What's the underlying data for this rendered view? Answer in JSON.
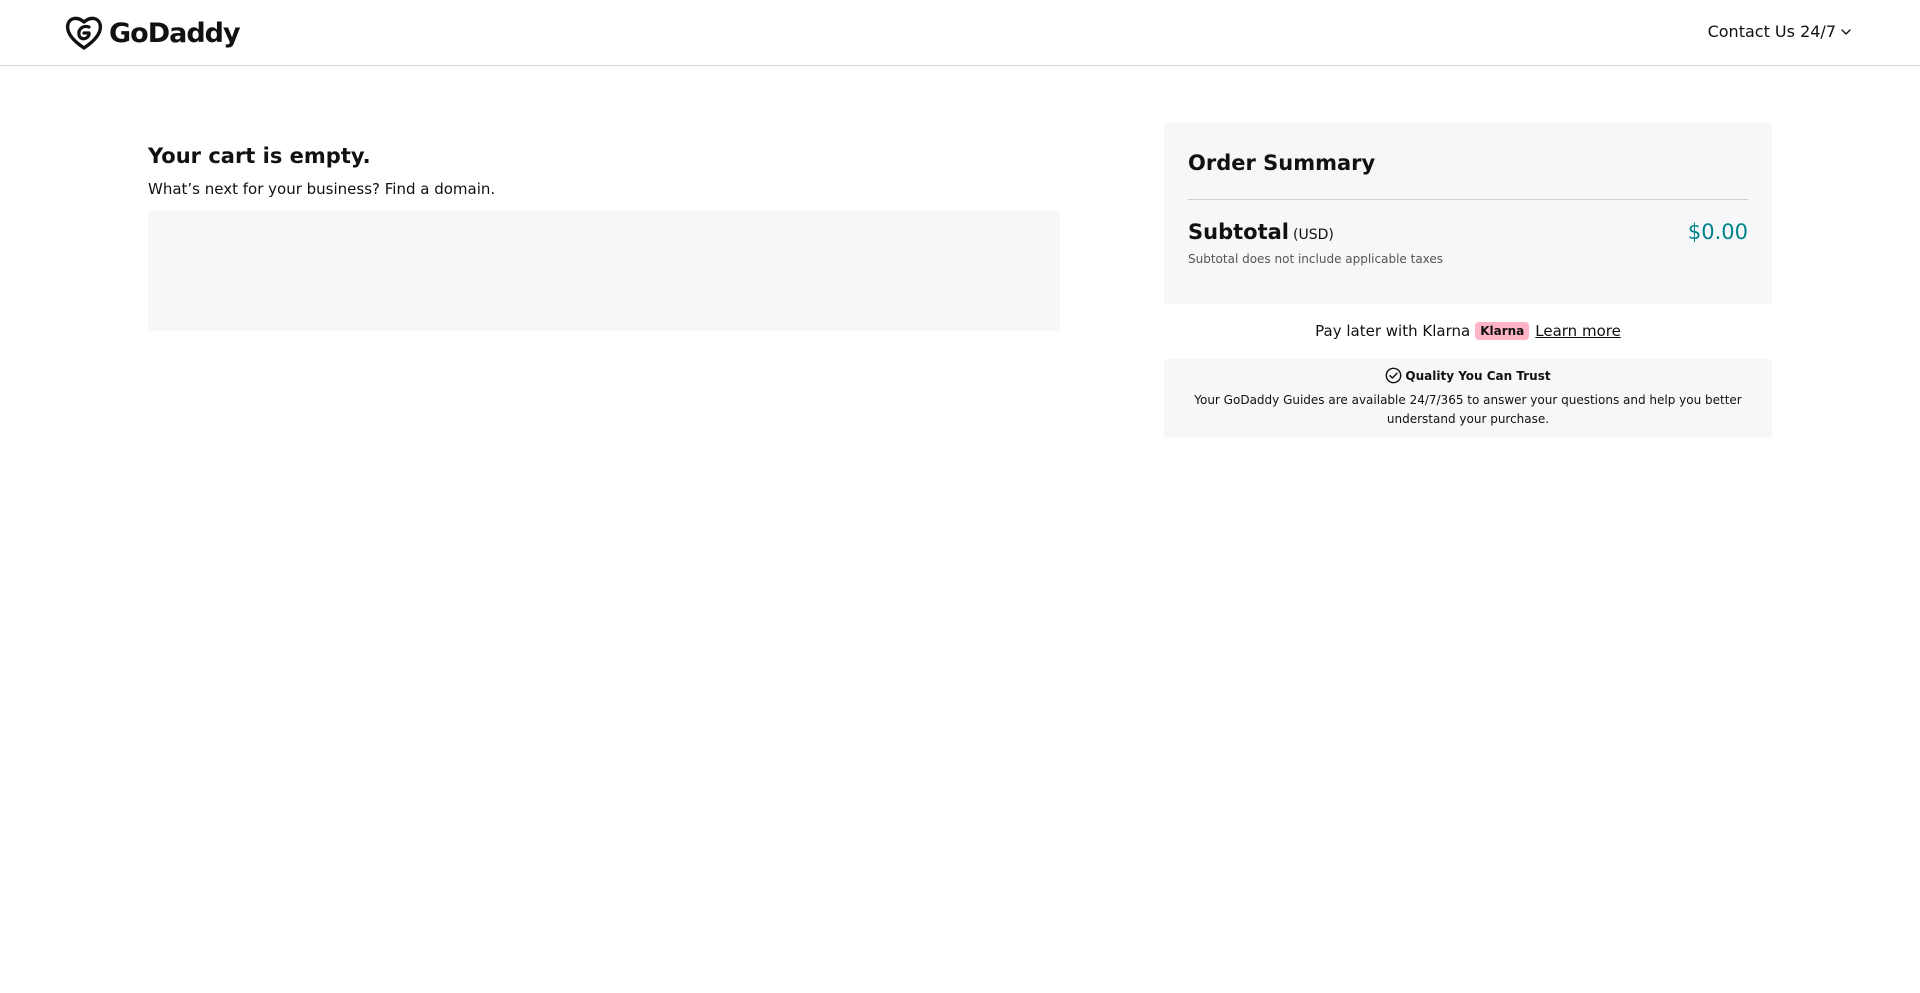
{
  "header": {
    "logo_text": "GoDaddy",
    "contact_label": "Contact Us 24/7"
  },
  "cart": {
    "title": "Your cart is empty.",
    "subtitle": "What’s next for your business? Find a domain."
  },
  "summary": {
    "title": "Order Summary",
    "subtotal_label": "Subtotal",
    "currency": "(USD)",
    "amount": "$0.00",
    "tax_note": "Subtotal does not include applicable taxes"
  },
  "klarna": {
    "text": "Pay later with Klarna",
    "badge": "Klarna",
    "link": "Learn more"
  },
  "trust": {
    "heading": "Quality You Can Trust",
    "text": "Your GoDaddy Guides are available 24/7/365 to answer your questions and help you better understand your purchase."
  },
  "colors": {
    "accent_price": "#00838c",
    "klarna_pink": "#ffb3c7",
    "panel_bg": "#f5f7f8"
  },
  "icons": {
    "logo": "godaddy-logo-icon",
    "contact": "chevron-down-icon",
    "trust": "check-circle-icon"
  }
}
